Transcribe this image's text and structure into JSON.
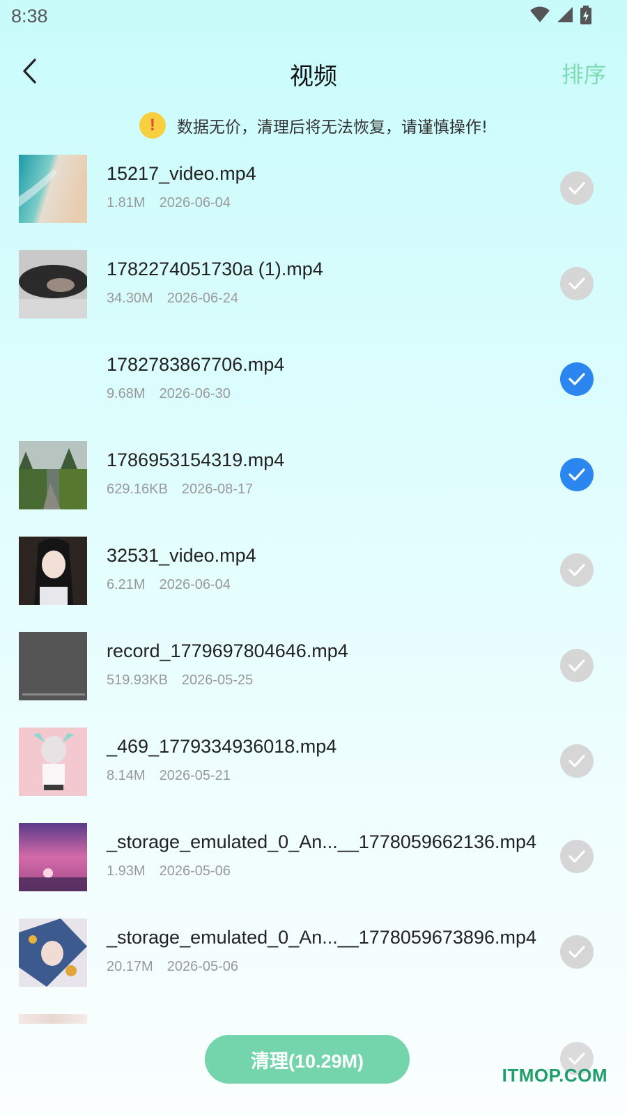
{
  "status_bar": {
    "time": "8:38",
    "icons": [
      "wifi-icon",
      "signal-icon",
      "battery-charging-icon"
    ]
  },
  "header": {
    "title": "视频",
    "sort_label": "排序",
    "back_icon": "chevron-left-icon"
  },
  "warning": {
    "text": "数据无价，清理后将无法恢复，请谨慎操作!",
    "icon_glyph": "!"
  },
  "files": [
    {
      "name": "15217_video.mp4",
      "size": "1.81M",
      "date": "2026-06-04",
      "selected": false,
      "thumbnail": "beach-aerial"
    },
    {
      "name": "1782274051730a (1).mp4",
      "size": "34.30M",
      "date": "2026-06-24",
      "selected": false,
      "thumbnail": "woman-in-water"
    },
    {
      "name": "1782783867706.mp4",
      "size": "9.68M",
      "date": "2026-06-30",
      "selected": true,
      "thumbnail": "none"
    },
    {
      "name": "1786953154319.mp4",
      "size": "629.16KB",
      "date": "2026-08-17",
      "selected": true,
      "thumbnail": "forest-river"
    },
    {
      "name": "32531_video.mp4",
      "size": "6.21M",
      "date": "2026-06-04",
      "selected": false,
      "thumbnail": "anime-girl-dark-hair"
    },
    {
      "name": "record_1779697804646.mp4",
      "size": "519.93KB",
      "date": "2026-05-25",
      "selected": false,
      "thumbnail": "dark-screen-recording"
    },
    {
      "name": "_469_1779334936018.mp4",
      "size": "8.14M",
      "date": "2026-05-21",
      "selected": false,
      "thumbnail": "anime-girl-pink"
    },
    {
      "name": "_storage_emulated_0_An...__1778059662136.mp4",
      "size": "1.93M",
      "date": "2026-05-06",
      "selected": false,
      "thumbnail": "sunset-city"
    },
    {
      "name": "_storage_emulated_0_An...__1778059673896.mp4",
      "size": "20.17M",
      "date": "2026-05-06",
      "selected": false,
      "thumbnail": "anime-character-blue"
    }
  ],
  "clean_button": {
    "label": "清理(10.29M)"
  },
  "watermark": "ITMOP.COM",
  "colors": {
    "accent_green": "#74d4ab",
    "sort_green": "#7fdcb2",
    "check_blue": "#2b86f0",
    "check_grey": "#d6d6d6",
    "warning_yellow": "#f7cf3f",
    "warning_red": "#e8473c"
  }
}
